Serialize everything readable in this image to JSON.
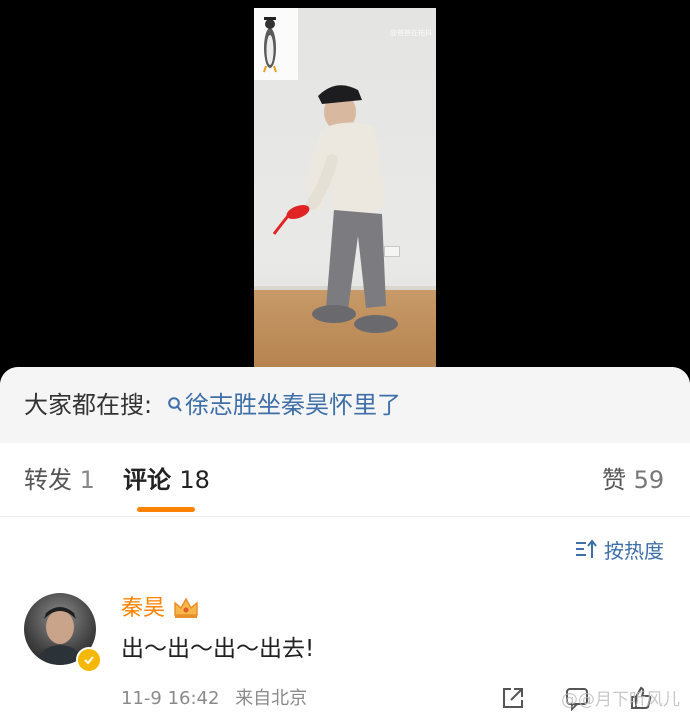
{
  "video": {
    "watermark": "@爸爸在拍抖"
  },
  "search": {
    "prefix": "大家都在搜:",
    "query": "徐志胜坐秦昊怀里了"
  },
  "tabs": [
    {
      "label": "转发",
      "count": "1"
    },
    {
      "label": "评论",
      "count": "18"
    },
    {
      "label": "赞",
      "count": "59"
    }
  ],
  "sort": {
    "label": "按热度"
  },
  "comment": {
    "username": "秦昊",
    "text": "出～出～出～出去!",
    "timestamp": "11-9 16:42",
    "location": "来自北京"
  },
  "page_watermark": "@@月下听风儿",
  "colors": {
    "accent": "#ff8200",
    "link": "#3e6fa8"
  }
}
